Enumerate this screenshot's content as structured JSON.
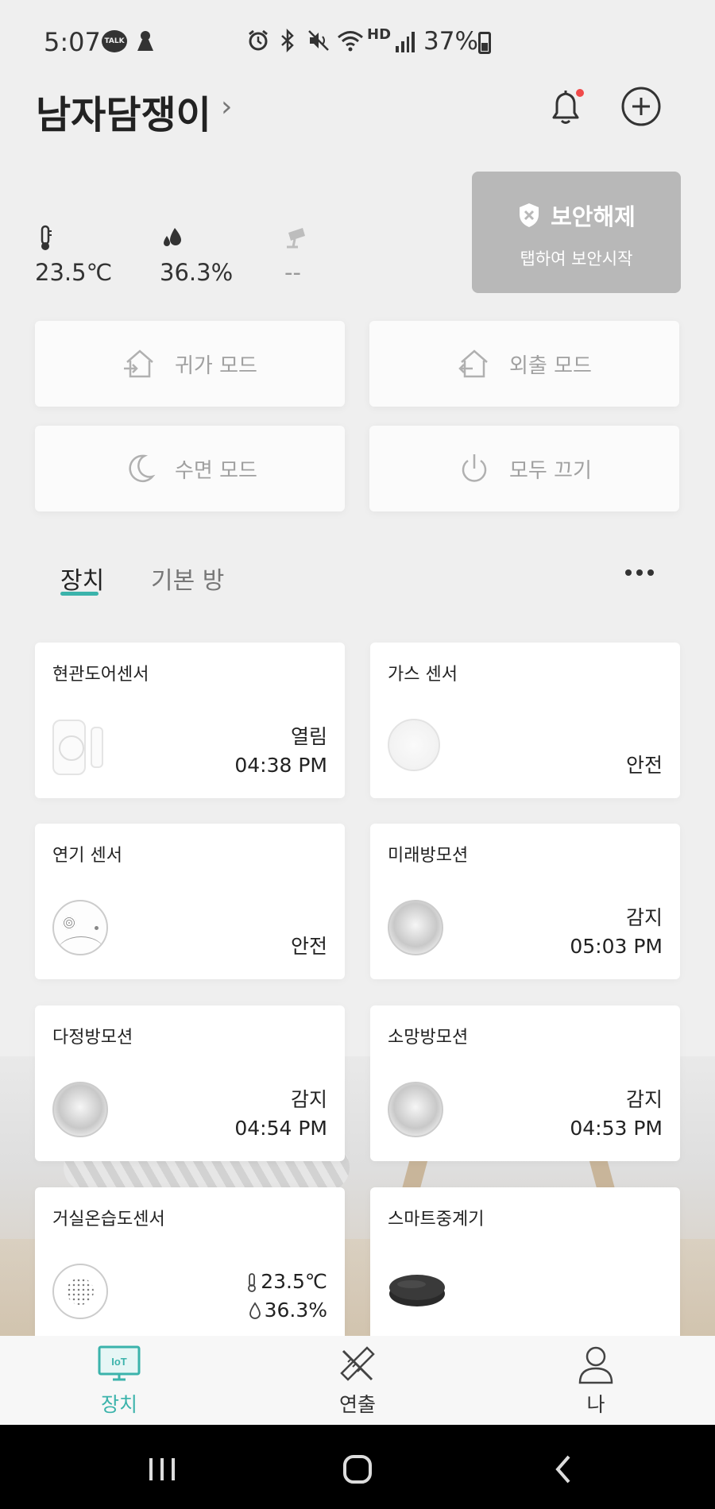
{
  "status_bar": {
    "time": "5:07",
    "talk_badge": "TALK",
    "hd_label": "HD",
    "battery_text": "37%"
  },
  "header": {
    "home_name": "남자담쟁이"
  },
  "environment": {
    "temperature": "23.5℃",
    "humidity": "36.3%",
    "camera": "--"
  },
  "security": {
    "title": "보안해제",
    "subtitle": "탭하여 보안시작"
  },
  "modes": [
    {
      "label": "귀가 모드"
    },
    {
      "label": "외출 모드"
    },
    {
      "label": "수면 모드"
    },
    {
      "label": "모두 끄기"
    }
  ],
  "tabs": {
    "devices": "장치",
    "default_room": "기본 방"
  },
  "devices": [
    {
      "name": "현관도어센서",
      "status": "열림",
      "time": "04:38 PM"
    },
    {
      "name": "가스 센서",
      "status": "안전"
    },
    {
      "name": "연기 센서",
      "status": "안전"
    },
    {
      "name": "미래방모션",
      "status": "감지",
      "time": "05:03 PM"
    },
    {
      "name": "다정방모션",
      "status": "감지",
      "time": "04:54 PM"
    },
    {
      "name": "소망방모션",
      "status": "감지",
      "time": "04:53 PM"
    },
    {
      "name": "거실온습도센서",
      "temperature": "23.5℃",
      "humidity": "36.3%"
    },
    {
      "name": "스마트중계기"
    }
  ],
  "bottom_nav": {
    "devices": "장치",
    "iot_badge": "IoT",
    "scenes": "연출",
    "me": "나",
    "active": "장치"
  },
  "colors": {
    "accent": "#3bb3ab",
    "security_card": "#b8b8b8",
    "notification_dot": "#f04a4a",
    "background": "#efefef"
  }
}
